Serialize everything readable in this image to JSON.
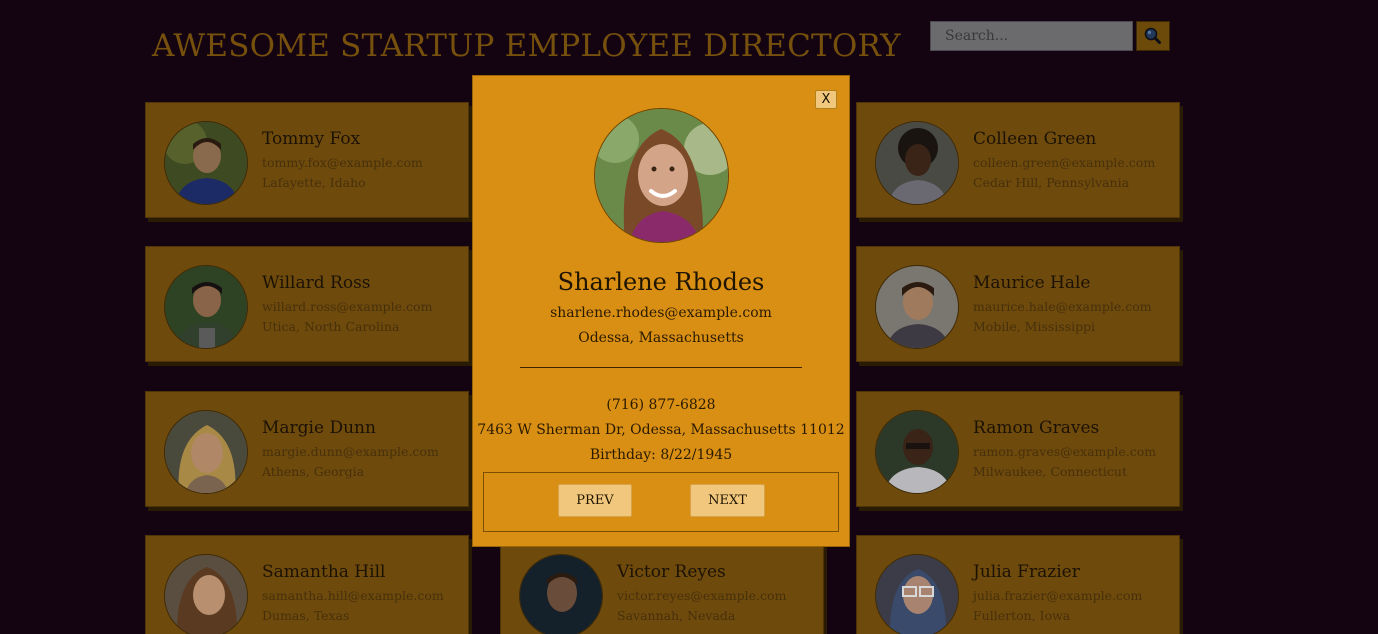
{
  "header": {
    "title": "AWESOME STARTUP EMPLOYEE DIRECTORY",
    "search_placeholder": "Search...",
    "search_icon": "magnifier-icon"
  },
  "employees": [
    {
      "name": "Tommy Fox",
      "email": "tommy.fox@example.com",
      "location": "Lafayette, Idaho"
    },
    {
      "name": "Colleen Green",
      "email": "colleen.green@example.com",
      "location": "Cedar Hill, Pennsylvania"
    },
    {
      "name": "Willard Ross",
      "email": "willard.ross@example.com",
      "location": "Utica, North Carolina"
    },
    {
      "name": "Maurice Hale",
      "email": "maurice.hale@example.com",
      "location": "Mobile, Mississippi"
    },
    {
      "name": "Margie Dunn",
      "email": "margie.dunn@example.com",
      "location": "Athens, Georgia"
    },
    {
      "name": "Ramon Graves",
      "email": "ramon.graves@example.com",
      "location": "Milwaukee, Connecticut"
    },
    {
      "name": "Samantha Hill",
      "email": "samantha.hill@example.com",
      "location": "Dumas, Texas"
    },
    {
      "name": "Victor Reyes",
      "email": "victor.reyes@example.com",
      "location": "Savannah, Nevada"
    },
    {
      "name": "Julia Frazier",
      "email": "julia.frazier@example.com",
      "location": "Fullerton, Iowa"
    }
  ],
  "modal": {
    "close_label": "X",
    "name": "Sharlene Rhodes",
    "email": "sharlene.rhodes@example.com",
    "city_state": "Odessa, Massachusetts",
    "phone": "(716) 877-6828",
    "address": "7463 W Sherman Dr, Odessa, Massachusetts 11012",
    "birthday": "Birthday: 8/22/1945",
    "prev_label": "PREV",
    "next_label": "NEXT"
  },
  "colors": {
    "background": "#140310",
    "card": "#6e4a0d",
    "modal": "#d88f14",
    "button": "#f1c77e"
  }
}
